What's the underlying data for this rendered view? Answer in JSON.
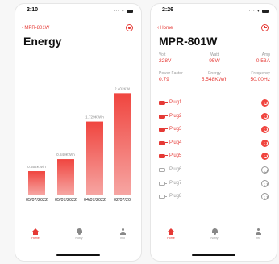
{
  "screen1": {
    "time": "2:10",
    "back_label": "MPR-801W",
    "title": "Energy",
    "tabs": [
      {
        "label": "Home",
        "icon": "home-icon"
      },
      {
        "label": "Notify",
        "icon": "bell-icon"
      },
      {
        "label": "Info",
        "icon": "user-icon"
      }
    ]
  },
  "chart_data": {
    "type": "bar",
    "categories": [
      "05/07/2022",
      "05/07/2022",
      "04/07/2022",
      "02/07/20"
    ],
    "values": [
      0.554,
      0.84,
      1.729,
      2.402
    ],
    "value_labels": [
      "0.554KW/h",
      "0.840KW/h",
      "1.729KW/h",
      "2.402KW"
    ],
    "title": "",
    "xlabel": "",
    "ylabel": "",
    "ylim": [
      0,
      2.6
    ],
    "colors": {
      "bar_top": "#f0453f",
      "bar_bottom": "#f6a5a2"
    }
  },
  "screen2": {
    "time": "2:26",
    "back_label": "Home",
    "title": "MPR-801W",
    "stats": [
      {
        "key": "Volt",
        "value": "228V"
      },
      {
        "key": "Watt",
        "value": "95W"
      },
      {
        "key": "Amp",
        "value": "0.53A"
      },
      {
        "key": "Power Factor",
        "value": "0.79"
      },
      {
        "key": "Energy",
        "value": "5.548KW/h"
      },
      {
        "key": "Frequency",
        "value": "50.00Hz"
      }
    ],
    "plugs": [
      {
        "name": "Plug1",
        "on": true
      },
      {
        "name": "Plug2",
        "on": true
      },
      {
        "name": "Plug3",
        "on": true
      },
      {
        "name": "Plug4",
        "on": true
      },
      {
        "name": "Plug5",
        "on": true
      },
      {
        "name": "Plug6",
        "on": false
      },
      {
        "name": "Plug7",
        "on": false
      },
      {
        "name": "Plug8",
        "on": false
      }
    ],
    "tabs": [
      {
        "label": "Home",
        "icon": "home-icon"
      },
      {
        "label": "Notify",
        "icon": "bell-icon"
      },
      {
        "label": "Info",
        "icon": "user-icon"
      }
    ]
  },
  "colors": {
    "accent": "#e53935"
  }
}
